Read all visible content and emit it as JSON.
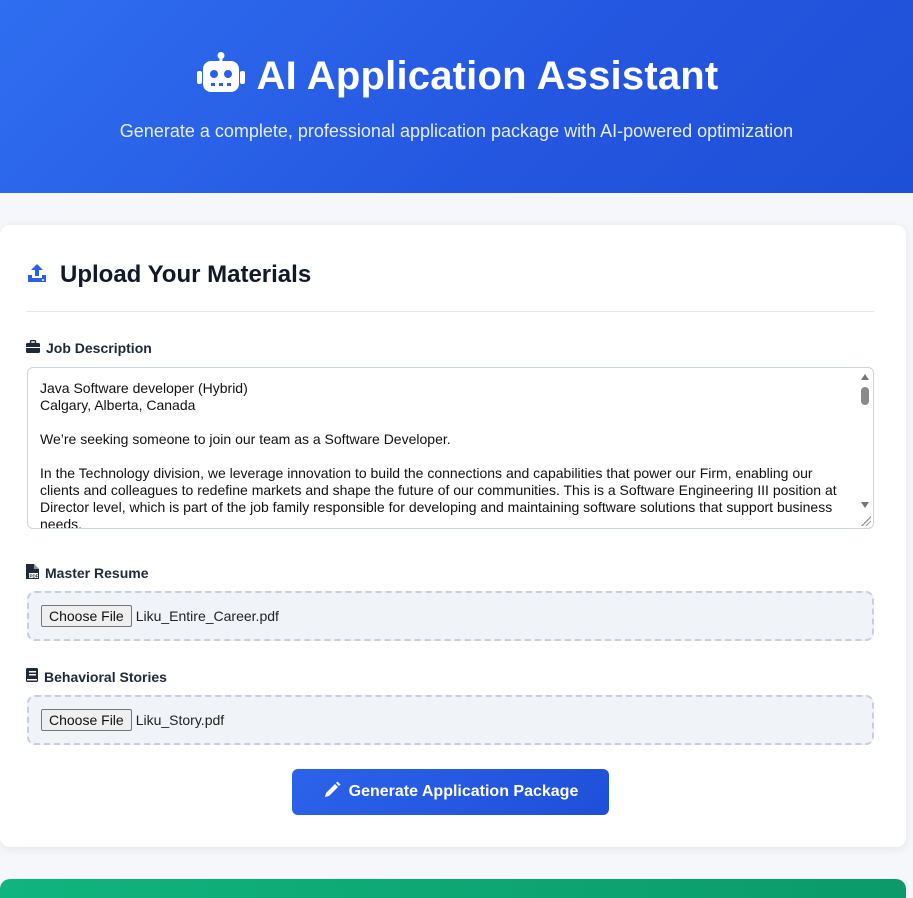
{
  "header": {
    "title": "AI Application Assistant",
    "subtitle": "Generate a complete, professional application package with AI-powered optimization",
    "icon": "robot-icon"
  },
  "upload": {
    "heading": "Upload Your Materials",
    "heading_icon": "upload-icon",
    "job": {
      "label": "Job Description",
      "icon": "briefcase-icon",
      "text": "Java Software developer (Hybrid)\nCalgary, Alberta, Canada\n\nWe’re seeking someone to join our team as a Software Developer.\n\nIn the Technology division, we leverage innovation to build the connections and capabilities that power our Firm, enabling our clients and colleagues to redefine markets and shape the future of our communities. This is a Software Engineering III position at Director level, which is part of the job family responsible for developing and maintaining software solutions that support business needs."
    },
    "resume": {
      "label": "Master Resume",
      "icon": "pdf-file-icon",
      "button": "Choose File",
      "file": "Liku_Entire_Career.pdf"
    },
    "stories": {
      "label": "Behavioral Stories",
      "icon": "book-icon",
      "button": "Choose File",
      "file": "Liku_Story.pdf"
    },
    "generate_button": "Generate Application Package",
    "generate_icon": "pencil-icon"
  },
  "colors": {
    "hero": "#2456e0",
    "accent": "#2b63ea",
    "success": "#10b47e"
  }
}
